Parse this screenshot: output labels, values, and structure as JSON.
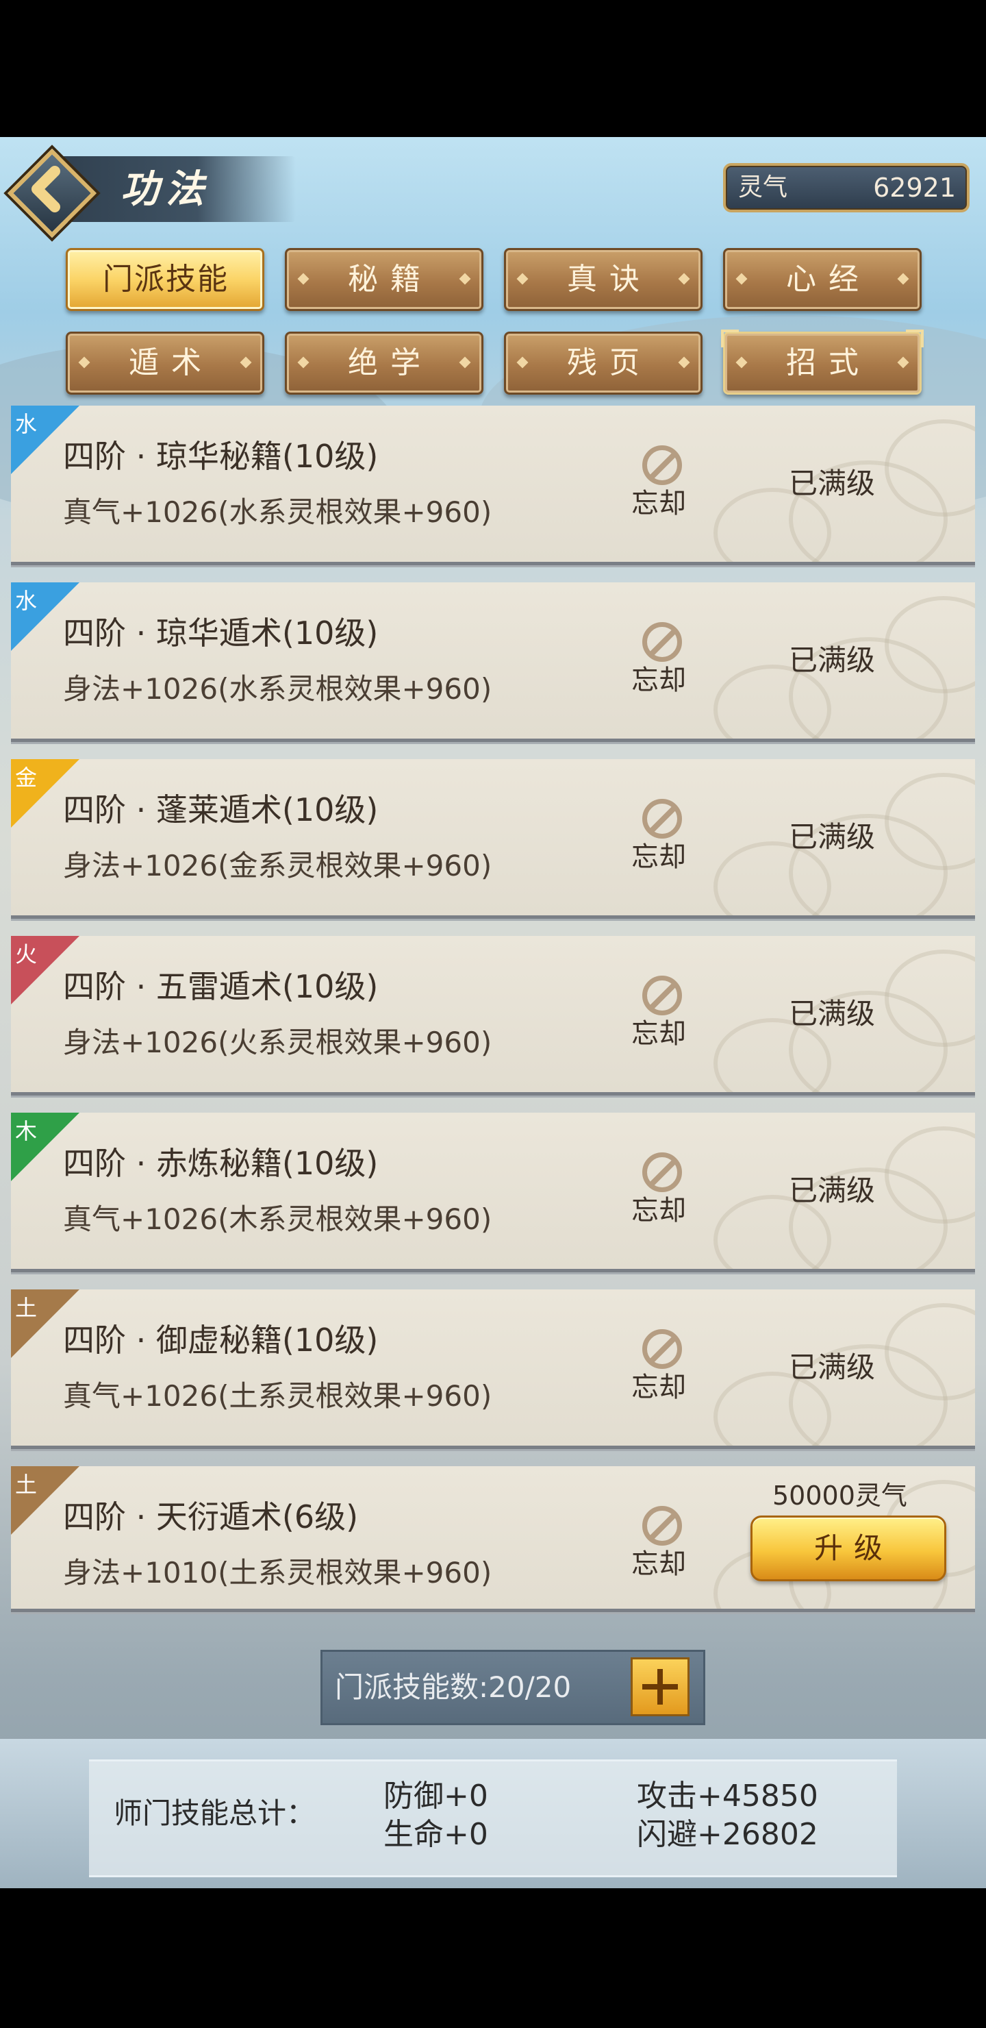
{
  "header": {
    "title": "功法",
    "currency_label": "灵气",
    "currency_value": "62921"
  },
  "tabs": [
    {
      "label": "门派技能",
      "active": true
    },
    {
      "label": "秘籍"
    },
    {
      "label": "真诀"
    },
    {
      "label": "心经"
    },
    {
      "label": "遁术"
    },
    {
      "label": "绝学"
    },
    {
      "label": "残页"
    },
    {
      "label": "招式"
    }
  ],
  "skills": [
    {
      "element": "水",
      "element_color": "#3aa0e0",
      "name": "四阶 · 琼华秘籍(10级)",
      "desc": "真气+1026(水系灵根效果+960)",
      "forget": "忘却",
      "status": "已满级"
    },
    {
      "element": "水",
      "element_color": "#3aa0e0",
      "name": "四阶 · 琼华遁术(10级)",
      "desc": "身法+1026(水系灵根效果+960)",
      "forget": "忘却",
      "status": "已满级"
    },
    {
      "element": "金",
      "element_color": "#f0b21c",
      "name": "四阶 · 蓬莱遁术(10级)",
      "desc": "身法+1026(金系灵根效果+960)",
      "forget": "忘却",
      "status": "已满级"
    },
    {
      "element": "火",
      "element_color": "#c8505a",
      "name": "四阶 · 五雷遁术(10级)",
      "desc": "身法+1026(火系灵根效果+960)",
      "forget": "忘却",
      "status": "已满级"
    },
    {
      "element": "木",
      "element_color": "#2fa048",
      "name": "四阶 · 赤炼秘籍(10级)",
      "desc": "真气+1026(木系灵根效果+960)",
      "forget": "忘却",
      "status": "已满级"
    },
    {
      "element": "土",
      "element_color": "#a57a4a",
      "name": "四阶 · 御虚秘籍(10级)",
      "desc": "真气+1026(土系灵根效果+960)",
      "forget": "忘却",
      "status": "已满级"
    },
    {
      "element": "土",
      "element_color": "#a57a4a",
      "name": "四阶 · 天衍遁术(6级)",
      "desc": "身法+1010(土系灵根效果+960)",
      "forget": "忘却",
      "cost": "50000灵气",
      "upgrade_label": "升级"
    }
  ],
  "counter": {
    "label": "门派技能数:20/20"
  },
  "summary": {
    "title": "师门技能总计：",
    "defense": "防御+0",
    "hp": "生命+0",
    "attack": "攻击+45850",
    "dodge": "闪避+26802"
  }
}
